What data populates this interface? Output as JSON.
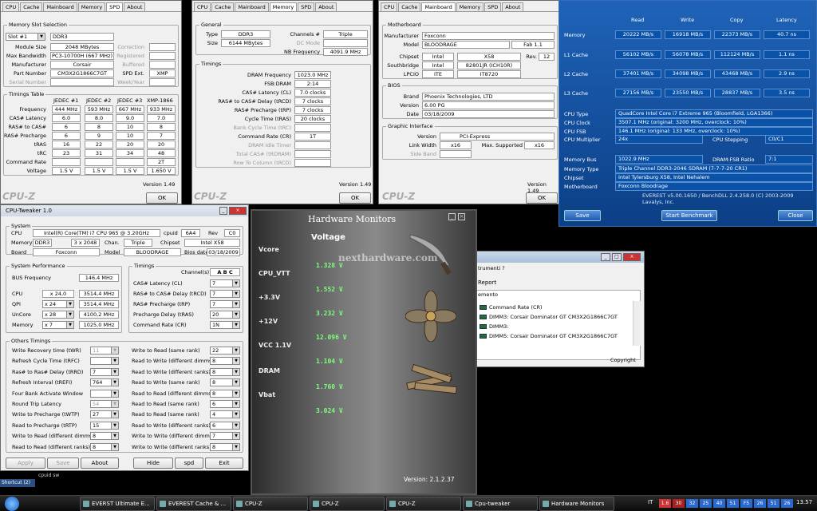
{
  "cpuz1": {
    "tabs": [
      "CPU",
      "Cache",
      "Mainboard",
      "Memory",
      "SPD",
      "About"
    ],
    "active": 4,
    "slot_group": "Memory Slot Selection",
    "slot": "Slot #1",
    "ddr": "DDR3",
    "labels": [
      "Module Size",
      "Max Bandwidth",
      "Manufacturer",
      "Part Number",
      "Serial Number"
    ],
    "values": [
      "2048 MBytes",
      "PC3-10700H (667 MHz)",
      "Corsair",
      "CM3X2G1866C7GT",
      ""
    ],
    "rlabels": [
      "Correction",
      "Registered",
      "Buffered",
      "SPD Ext.",
      "Week/Year"
    ],
    "rvalues": [
      "",
      "",
      "",
      "XMP",
      ""
    ],
    "timings_group": "Timings Table",
    "cols": [
      "JEDEC #1",
      "JEDEC #2",
      "JEDEC #3",
      "XMP-1866"
    ],
    "rows": [
      [
        "Frequency",
        "444 MHz",
        "593 MHz",
        "667 MHz",
        "933 MHz"
      ],
      [
        "CAS# Latency",
        "6.0",
        "8.0",
        "9.0",
        "7.0"
      ],
      [
        "RAS# to CAS#",
        "6",
        "8",
        "10",
        "8"
      ],
      [
        "RAS# Precharge",
        "6",
        "9",
        "10",
        "7"
      ],
      [
        "tRAS",
        "16",
        "22",
        "20",
        "20"
      ],
      [
        "tRC",
        "23",
        "31",
        "34",
        "48"
      ],
      [
        "Command Rate",
        "",
        "",
        "",
        "2T"
      ],
      [
        "Voltage",
        "1.5 V",
        "1.5 V",
        "1.5 V",
        "1.650 V"
      ]
    ],
    "version": "Version 1.49",
    "ok": "OK",
    "logo": "CPU-Z"
  },
  "cpuz2": {
    "tabs": [
      "CPU",
      "Cache",
      "Mainboard",
      "Memory",
      "SPD",
      "About"
    ],
    "active": 3,
    "general": "General",
    "type_l": "Type",
    "type_v": "DDR3",
    "size_l": "Size",
    "size_v": "6144 MBytes",
    "ch_l": "Channels #",
    "ch_v": "Triple",
    "dc_l": "DC Mode",
    "nb_l": "NB Frequency",
    "nb_v": "4091.9 MHz",
    "timings": "Timings",
    "tl": [
      "DRAM Frequency",
      "FSB:DRAM",
      "CAS# Latency (CL)",
      "RAS# to CAS# Delay (tRCD)",
      "RAS# Precharge (tRP)",
      "Cycle Time (tRAS)",
      "Bank Cycle Time (tRC)",
      "Command Rate (CR)",
      "DRAM Idle Timer",
      "Total CAS# (tRDRAM)",
      "Row To Column (tRCD)"
    ],
    "tv": [
      "1023.0 MHz",
      "2:14",
      "7.0 clocks",
      "7 clocks",
      "7 clocks",
      "20 clocks",
      "",
      "1T",
      "",
      "",
      ""
    ],
    "version": "Version 1.49",
    "ok": "OK",
    "logo": "CPU-Z"
  },
  "cpuz3": {
    "tabs": [
      "CPU",
      "Cache",
      "Mainboard",
      "Memory",
      "SPD",
      "About"
    ],
    "active": 2,
    "mb": "Motherboard",
    "man_l": "Manufacturer",
    "man_v": "Foxconn",
    "model_l": "Model",
    "model_v": "BLOODRAGE",
    "fab": "Fab 1.1",
    "chip_l": "Chipset",
    "chip_a": "Intel",
    "chip_b": "X58",
    "rev_l": "Rev.",
    "rev_v": "12",
    "sb_l": "Southbridge",
    "sb_a": "Intel",
    "sb_b": "82801JR (ICH10R)",
    "lpc_l": "LPCIO",
    "lpc_a": "ITE",
    "lpc_b": "IT8720",
    "bios": "BIOS",
    "brand_l": "Brand",
    "brand_v": "Phoenix Technologies, LTD",
    "ver_l": "Version",
    "ver_v": "6.00 PG",
    "date_l": "Date",
    "date_v": "03/18/2009",
    "gi": "Graphic Interface",
    "gver_l": "Version",
    "gver_v": "PCI-Express",
    "lw_l": "Link Width",
    "lw_v": "x16",
    "ms_l": "Max. Supported",
    "ms_v": "x16",
    "sb2_l": "Side Band",
    "version": "Version 1.49",
    "ok": "OK",
    "logo": "CPU-Z"
  },
  "everest": {
    "heads": [
      "Read",
      "Write",
      "Copy",
      "Latency"
    ],
    "rows": [
      [
        "Memory",
        "20222 MB/s",
        "16918 MB/s",
        "22373 MB/s",
        "40.7 ns"
      ],
      [
        "L1 Cache",
        "56102 MB/s",
        "56078 MB/s",
        "112124 MB/s",
        "1.1 ns"
      ],
      [
        "L2 Cache",
        "37401 MB/s",
        "34098 MB/s",
        "43468 MB/s",
        "2.9 ns"
      ],
      [
        "L3 Cache",
        "27156 MB/s",
        "23550 MB/s",
        "28837 MB/s",
        "3.5 ns"
      ]
    ],
    "info": [
      [
        "CPU Type",
        "QuadCore Intel Core i7 Extreme 965  (Bloomfield, LGA1366)"
      ],
      [
        "CPU Clock",
        "3507.1 MHz  (original: 3200 MHz, overclock: 10%)"
      ],
      [
        "CPU FSB",
        "146.1 MHz  (original: 133 MHz, overclock: 10%)"
      ]
    ],
    "mult_l": "CPU Multiplier",
    "mult_v": "24x",
    "step_l": "CPU Stepping",
    "step_v": "C0/C1",
    "bus_l": "Memory Bus",
    "bus_v": "1022.9 MHz",
    "ratio_l": "DRAM:FSB Ratio",
    "ratio_v": "7:1",
    "info2": [
      [
        "Memory Type",
        "Triple Channel DDR3-2046 SDRAM  (7-7-7-20 CR1)"
      ],
      [
        "Chipset",
        "Intel Tylersburg X58, Intel Nehalem"
      ],
      [
        "Motherboard",
        "Foxconn Bloodrage"
      ]
    ],
    "footer": "EVEREST v5.00.1650 / BenchDLL 2.4.258.0  (C) 2003-2009 Lavalys, Inc.",
    "save": "Save",
    "start": "Start Benchmark",
    "close": "Close"
  },
  "tweaker": {
    "title": "CPU-Tweaker 1.0",
    "system": "System",
    "cpu_l": "CPU",
    "cpu_v": "Intel(R) Core(TM) i7 CPU      965  @ 3.20GHz",
    "cpuid_l": "cpuid",
    "cpuid_v": "6A4",
    "rev_l": "Rev",
    "rev_v": "C0",
    "mem_l": "Memory",
    "mem_v": "DDR3",
    "mem_s": "3 x 2048",
    "chan_l": "Chan.",
    "chan_v": "Triple",
    "chip_l": "Chipset",
    "chip_v": "Intel X58",
    "board_l": "Board",
    "board_v": "Foxconn",
    "model_l": "Model",
    "model_v": "BLOODRAGE",
    "bios_l": "Bios date",
    "bios_v": "03/18/2009",
    "sysperf": "System Performance",
    "bus_l": "BUS Frequency",
    "bus_v": "146,4 MHz",
    "cpu2_l": "CPU",
    "cpu2_m": "x 24,0",
    "cpu2_v": "3514,4 MHz",
    "qpi_l": "QPI",
    "qpi_m": "x 24",
    "qpi_v": "3514,4 MHz",
    "unc_l": "UnCore",
    "unc_m": "x 28",
    "unc_v": "4100,2 MHz",
    "memr_l": "Memory",
    "memr_m": "x 7",
    "memr_v": "1025,0 MHz",
    "timings": "Timings",
    "chans_l": "Channel(s)",
    "chans_v": "A B C",
    "tl": [
      "CAS# Latency (CL)",
      "RAS# to CAS# Delay (tRCD)",
      "RAS# Precharge (tRP)",
      "Precharge Delay (tRAS)",
      "Command Rate (CR)"
    ],
    "tv": [
      "7",
      "7",
      "7",
      "20",
      "1N"
    ],
    "others": "Others Timings",
    "ol": [
      "Write Recovery time (tWR)",
      "Refresh Cycle Time (tRFC)",
      "Ras# to Ras# Delay (tRRD)",
      "Refresh Interval (tREFI)",
      "Four Bank Activate Window",
      "Round Trip Latency",
      "Write to Precharge (tWTP)",
      "Read to Precharge (tRTP)",
      "Write to Read (different dimms)",
      "Read to Read (different ranks)"
    ],
    "ov": [
      "11",
      "",
      "7",
      "764",
      "",
      "54",
      "27",
      "15",
      "8",
      "8"
    ],
    "rl": [
      "Write to Read (same rank)",
      "Read to Write (different dimms)",
      "Read to Write (different ranks)",
      "Read to Write (same rank)",
      "Read to Read (different dimms)",
      "Read to Read (same rank)",
      "Read to Read (same rank)",
      "Read to Write (different ranks)",
      "Write to Write (different dimms)",
      "Write to Write (different ranks)"
    ],
    "rv": [
      "22",
      "8",
      "8",
      "8",
      "8",
      "6",
      "4",
      "6",
      "7",
      "8"
    ],
    "apply": "Apply",
    "save": "Save",
    "about": "About",
    "hide": "Hide",
    "spd": "spd",
    "exit": "Exit"
  },
  "hwmon": {
    "title": "Hardware Monitors",
    "voltage": "Voltage",
    "watermark": "nexthardware.com",
    "labels": [
      "Vcore",
      "CPU_VTT",
      "+3.3V",
      "+12V",
      "VCC 1.1V",
      "DRAM",
      "Vbat"
    ],
    "values": [
      "1.328 V",
      "1.552 V",
      "3.232 V",
      "12.096 V",
      "1.104 V",
      "1.760 V",
      "3.024 V"
    ],
    "version": "Version:  2.1.2.37"
  },
  "sidewin": {
    "menu": "trumenti   ?",
    "report": "Report",
    "col": "emento",
    "items": [
      "Command Rate (CR)",
      "DIMM3: Corsair Dominator GT CM3X2G1866C7GT",
      "DIMM3:",
      "DIMM5: Corsair Dominator GT CM3X2G1866C7GT"
    ],
    "copyright": "Copyright"
  },
  "desktop": {
    "shortcut": "Shortcut (2)",
    "cpuidsw": "cpuid sw"
  },
  "taskbar": {
    "items": [
      "EVERST Ultimate E...",
      "EVEREST Cache & ...",
      "CPU-Z",
      "CPU-Z",
      "CPU-Z",
      "Cpu-tweaker",
      "Hardware Monitors"
    ],
    "lang": "IT",
    "tray": [
      "1.6",
      "30",
      "32",
      "25",
      "40",
      "51",
      "F5",
      "26",
      "51",
      "26"
    ],
    "clock": "13.57"
  }
}
